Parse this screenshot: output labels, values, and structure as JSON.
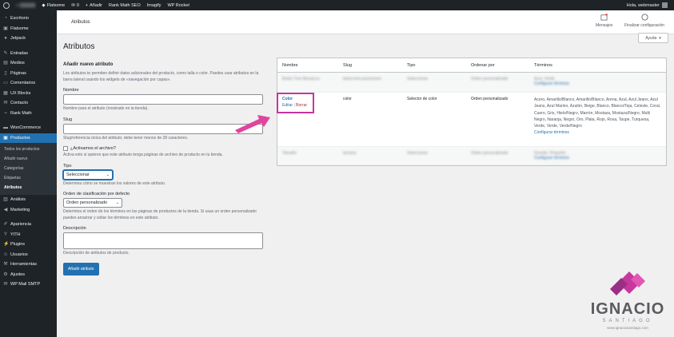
{
  "adminbar": {
    "site": "Flatsome",
    "comments_count": "0",
    "new": "Añadir",
    "rank_math": "Rank Math SEO",
    "imagify": "Imagify",
    "wp_rocket": "WP Rocket",
    "greeting": "Hola, webmaster"
  },
  "sidebar": {
    "items": [
      {
        "label": "Escritorio",
        "icon": "dashboard-icon"
      },
      {
        "label": "Flatsome",
        "icon": "flatsome-icon"
      },
      {
        "label": "Jetpack",
        "icon": "jetpack-icon"
      },
      {
        "label": "Entradas",
        "icon": "pin-icon"
      },
      {
        "label": "Medios",
        "icon": "media-icon"
      },
      {
        "label": "Páginas",
        "icon": "page-icon"
      },
      {
        "label": "Comentarios",
        "icon": "comment-icon"
      },
      {
        "label": "UX Blocks",
        "icon": "blocks-icon"
      },
      {
        "label": "Contacto",
        "icon": "mail-icon"
      },
      {
        "label": "Rank Math",
        "icon": "chart-icon"
      },
      {
        "label": "WooCommerce",
        "icon": "woo-icon"
      },
      {
        "label": "Productos",
        "icon": "archive-icon"
      }
    ],
    "submenu": [
      "Todos los productos",
      "Añadir nuevo",
      "Categorías",
      "Etiquetas",
      "Atributos"
    ],
    "items_after": [
      {
        "label": "Análisis",
        "icon": "bar-chart-icon"
      },
      {
        "label": "Marketing",
        "icon": "megaphone-icon"
      },
      {
        "label": "Apariencia",
        "icon": "brush-icon"
      },
      {
        "label": "YITH",
        "icon": "yith-icon"
      },
      {
        "label": "Plugins",
        "icon": "plugin-icon"
      },
      {
        "label": "Usuarios",
        "icon": "users-icon"
      },
      {
        "label": "Herramientas",
        "icon": "wrench-icon"
      },
      {
        "label": "Ajustes",
        "icon": "settings-icon"
      },
      {
        "label": "WP Mail SMTP",
        "icon": "mail-smtp-icon"
      }
    ]
  },
  "topbar": {
    "breadcrumb": "Atributos",
    "messages": "Mensajes",
    "finish_setup": "Finalizar configuración",
    "help": "Ayuda"
  },
  "page_title": "Atributos",
  "form": {
    "heading": "Añadir nuevo atributo",
    "intro": "Los atributos te permiten definir datos adicionales del producto, como talla o color. Puedes usar atributos en la barra lateral usando los widgets de «navegación por capas».",
    "name_label": "Nombre",
    "name_desc": "Nombre para el atributo (mostrado en la tienda).",
    "slug_label": "Slug",
    "slug_desc": "Slug/referencia única del atributo; debe tener menos de 28 caracteres.",
    "archive_label": "¿Activamos el archivo?",
    "archive_desc": "Activa esto si quieres que este atributo tenga páginas de archivo de producto en tu tienda.",
    "type_label": "Tipo",
    "type_value": "Seleccionar",
    "type_desc": "Determina cómo se muestran los valores de este atributo.",
    "order_label": "Orden de clasificación por defecto",
    "order_value": "Orden personalizado",
    "order_desc": "Determina el orden de los términos en las páginas de productos de la tienda. Si usas un orden personalizado puedes arrastrar y soltar los términos en este atributo.",
    "description_label": "Descripción",
    "description_desc": "Descripción de atributos de producto.",
    "submit": "Añadir atributo"
  },
  "table": {
    "headers": [
      "Nombre",
      "Slug",
      "Tipo",
      "Ordenar por",
      "Términos"
    ],
    "row1": {
      "name": "Botón Tres Mosaicos",
      "slug": "boton-tres-posicioneo",
      "type": "Seleccionar",
      "order": "Orden personalizado",
      "terms": "Azul, Verde",
      "configure": "Configurar términos"
    },
    "color": {
      "name": "Color",
      "edit": "Editar",
      "sep": "|",
      "delete": "Borrar",
      "slug": "color",
      "type": "Selector de color",
      "order": "Orden personalizado",
      "terms": "Acero, Amarillo/Blanco, Amarillo/Blanco, Arena, Azul, Azul Jeans, Azul Jeans, Azul Marino, Azulón, Beige, Blanco, Blanco/Teja, Celeste, Coral, Cuero, Gris, Hielo/Negro, Marrón, Mostaza, Mostaza/Negro, Multi Negro, Naranja, Negro, Oro, Plata, Rojo, Rosa, Taupe, Turquesa, Verde, Verde, Verde/Negro",
      "configure": "Configurar términos"
    },
    "row3": {
      "name": "Tamaño",
      "slug": "tamano",
      "type": "Seleccionar",
      "order": "Orden personalizado",
      "terms": "Grande, Pequeño",
      "configure": "Configurar términos"
    }
  },
  "watermark": {
    "name": "IGNACIO",
    "surname": "SANTIAGO",
    "url": "www.ignaciosantiago.com"
  },
  "colors": {
    "accent": "#2271b1",
    "highlight": "#c7359f",
    "sidebar_bg": "#1d2327"
  }
}
